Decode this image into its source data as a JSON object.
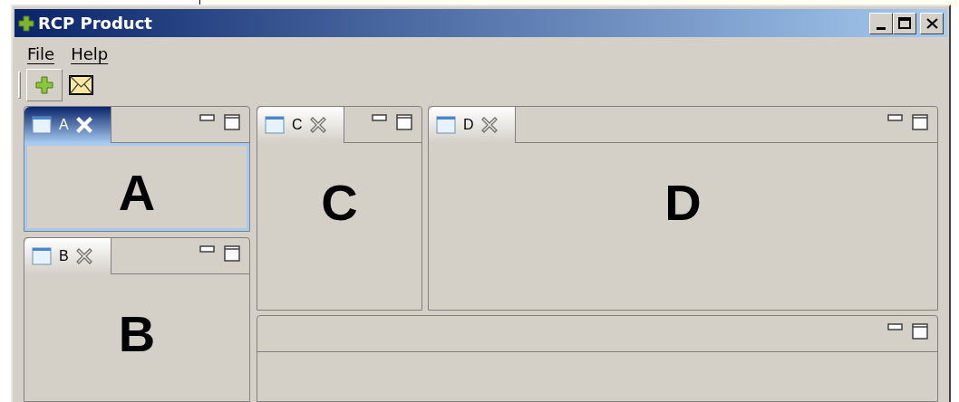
{
  "window": {
    "title": "RCP Product"
  },
  "menu": [
    {
      "label": "File"
    },
    {
      "label": "Help"
    }
  ],
  "toolbar": [
    {
      "kind": "add",
      "pressed": true
    },
    {
      "kind": "mail",
      "pressed": false
    }
  ],
  "left_views": [
    {
      "tab": "A",
      "content": "A",
      "active": true
    },
    {
      "tab": "B",
      "content": "B",
      "active": false
    }
  ],
  "right_views": [
    {
      "tab": "C",
      "content": "C",
      "active": false
    },
    {
      "tab": "D",
      "content": "D",
      "active": false
    }
  ]
}
